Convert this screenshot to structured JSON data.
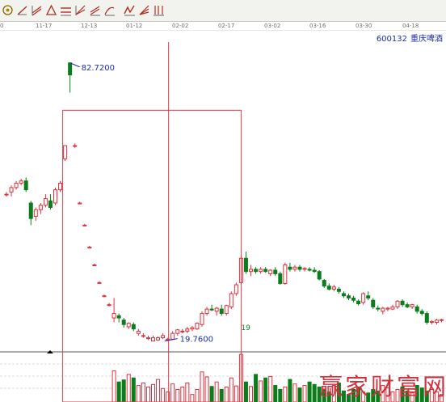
{
  "toolbar": {
    "buttons": [
      {
        "icon": "ring-icon"
      },
      {
        "icon": "trend-line-icon"
      },
      {
        "icon": "parallel-lines-icon"
      },
      {
        "icon": "triangle-icon"
      },
      {
        "icon": "horizontal-line-icon"
      },
      {
        "icon": "fan-lines-icon"
      },
      {
        "icon": "channel-icon"
      },
      {
        "icon": "arc-lines-icon"
      },
      {
        "icon": "zigzag-icon"
      },
      {
        "icon": "gann-fan-icon"
      }
    ]
  },
  "stock": {
    "code": "600132",
    "name": "重庆啤酒"
  },
  "dates": [
    "0",
    "11-17",
    "12-13",
    "01-12",
    "02-02",
    "02-17",
    "03-02",
    "03-16",
    "03-30",
    "04-18"
  ],
  "watermark": "赢家财富网",
  "colors": {
    "up": "#e0303c",
    "down": "#0b7d1c",
    "box": "#e03c48",
    "annotation": "#1a2fa8"
  },
  "chart_data": {
    "type": "candlestick",
    "price_range": [
      17.5,
      90
    ],
    "volume_range": [
      0,
      100
    ],
    "annotations": [
      {
        "text": "82.7200",
        "candle": 12
      },
      {
        "text": "19.7600",
        "candle": 33
      }
    ],
    "markers": [
      {
        "text": "19",
        "candle": 48
      }
    ],
    "box": {
      "from_candle": 12,
      "to_candle": 48,
      "low": 19.76,
      "high": 72.0
    },
    "vertical_line_candle": 33,
    "candles": [
      [
        53,
        53.5,
        52.5,
        53
      ],
      [
        53.5,
        55,
        52.5,
        54.5
      ],
      [
        54.5,
        56,
        54,
        55.5
      ],
      [
        55.5,
        56.5,
        55,
        56
      ],
      [
        56,
        56.8,
        53.5,
        54
      ],
      [
        51,
        51.5,
        46,
        47.5
      ],
      [
        48,
        50,
        47,
        49.5
      ],
      [
        49.5,
        51,
        48.5,
        50.5
      ],
      [
        50.5,
        53,
        50,
        52
      ],
      [
        51.5,
        53,
        49.5,
        50
      ],
      [
        51,
        54.5,
        50.5,
        54
      ],
      [
        54,
        56,
        53.5,
        55.5
      ],
      [
        61,
        64,
        60.5,
        64
      ],
      [
        82.72,
        82.72,
        76,
        80
      ],
      [
        64,
        64.5,
        63.5,
        64
      ],
      [
        51,
        51.3,
        50.7,
        51
      ],
      [
        46,
        46.3,
        45.7,
        46
      ],
      [
        41,
        41.3,
        40.7,
        41
      ],
      [
        37,
        37.3,
        36.7,
        37
      ],
      [
        33,
        33.3,
        32.7,
        33
      ],
      [
        30,
        30.3,
        29.7,
        30
      ],
      [
        28,
        28.4,
        27.6,
        28
      ],
      [
        25,
        29.5,
        24,
        26
      ],
      [
        25.5,
        26,
        24,
        25
      ],
      [
        24.5,
        25,
        22.8,
        23.5
      ],
      [
        23,
        24,
        22.5,
        23.8
      ],
      [
        23.5,
        24,
        22,
        22.5
      ],
      [
        21.5,
        22.5,
        21,
        22
      ],
      [
        21,
        21.5,
        20.5,
        21
      ],
      [
        20.5,
        21,
        20,
        20.5
      ],
      [
        19.76,
        21,
        19.76,
        20.5
      ],
      [
        20,
        20.8,
        19.8,
        20.5
      ],
      [
        20.5,
        21.5,
        20.2,
        21
      ],
      [
        20,
        20.5,
        19.76,
        20.2
      ],
      [
        20.2,
        22,
        20,
        21.5
      ],
      [
        21.5,
        22.5,
        21,
        22.3
      ],
      [
        22,
        22.5,
        21.5,
        22
      ],
      [
        22,
        23,
        21.5,
        22.5
      ],
      [
        22.5,
        23.2,
        22,
        22.8
      ],
      [
        22.5,
        24,
        22.3,
        23.8
      ],
      [
        23.5,
        26.5,
        23,
        26
      ],
      [
        26,
        27.5,
        25.5,
        27
      ],
      [
        27,
        28,
        26.5,
        26.8
      ],
      [
        26.5,
        27.5,
        25.5,
        27.2
      ],
      [
        27,
        28,
        25.5,
        26
      ],
      [
        26,
        28,
        25.5,
        27.8
      ],
      [
        27.5,
        31,
        27,
        30.5
      ],
      [
        30.5,
        33,
        30,
        32.5
      ],
      [
        33,
        39,
        32.5,
        38.5
      ],
      [
        38.5,
        40,
        35,
        35.5
      ],
      [
        35.5,
        37,
        34.5,
        36
      ],
      [
        36,
        36.5,
        35,
        35.5
      ],
      [
        35.5,
        36.5,
        35,
        36
      ],
      [
        36,
        36.5,
        35.2,
        35.5
      ],
      [
        35,
        36,
        34.5,
        35.8
      ],
      [
        35.8,
        36.5,
        34.5,
        35
      ],
      [
        35,
        35.5,
        32.5,
        32.8
      ],
      [
        32.8,
        37.5,
        32.5,
        37
      ],
      [
        36.5,
        37.5,
        35.5,
        36
      ],
      [
        36,
        37,
        35.5,
        36.5
      ],
      [
        36.5,
        37,
        35.5,
        36
      ],
      [
        36,
        36.5,
        35.5,
        36.2
      ],
      [
        36,
        36.5,
        35.5,
        35.8
      ],
      [
        35.8,
        36.5,
        35.2,
        35.5
      ],
      [
        35.5,
        35.8,
        33.5,
        33.8
      ],
      [
        33.5,
        33.8,
        31.8,
        32.2
      ],
      [
        32.2,
        32.8,
        31.2,
        31.5
      ],
      [
        31.5,
        32.5,
        31,
        32
      ],
      [
        31.5,
        32,
        30.5,
        31
      ],
      [
        30.5,
        31,
        29.5,
        30
      ],
      [
        30,
        30.5,
        29,
        29.5
      ],
      [
        29.5,
        30,
        28.5,
        29
      ],
      [
        28.8,
        29.2,
        27.8,
        28.2
      ],
      [
        28.5,
        30.8,
        28,
        30.5
      ],
      [
        30,
        31,
        29,
        29.5
      ],
      [
        29,
        29.5,
        27,
        27.5
      ],
      [
        27.2,
        27.8,
        26.5,
        27
      ],
      [
        26.5,
        27.5,
        25.8,
        27.2
      ],
      [
        27,
        27.5,
        26.5,
        27.2
      ],
      [
        27,
        28,
        26.8,
        27.5
      ],
      [
        27.5,
        29,
        27,
        28.8
      ],
      [
        28.8,
        29.2,
        27.5,
        28
      ],
      [
        28,
        28.5,
        27.2,
        27.5
      ],
      [
        27.5,
        28.2,
        27,
        28
      ],
      [
        27.5,
        28,
        26,
        26.5
      ],
      [
        26.5,
        27,
        25.5,
        26
      ],
      [
        26,
        26.5,
        23.5,
        24
      ],
      [
        24,
        24.5,
        23.5,
        24.2
      ],
      [
        24,
        24.8,
        23.5,
        24.5
      ],
      [
        24.5,
        24.8,
        24,
        24.6
      ]
    ],
    "volumes": [
      0,
      0,
      0,
      0,
      0,
      0,
      0,
      0,
      0,
      0,
      0,
      0,
      0,
      0,
      0,
      0,
      0,
      0,
      0,
      0,
      0,
      0,
      62,
      40,
      44,
      55,
      48,
      33,
      38,
      30,
      35,
      45,
      27,
      20,
      36,
      25,
      30,
      38,
      15,
      25,
      60,
      50,
      31,
      40,
      25,
      30,
      48,
      32,
      95,
      40,
      31,
      55,
      42,
      48,
      51,
      33,
      25,
      30,
      45,
      36,
      28,
      33,
      40,
      35,
      30,
      25,
      20,
      33,
      38,
      22,
      15,
      25,
      30,
      20,
      18,
      25,
      22,
      33,
      28,
      20,
      25,
      30,
      22,
      18,
      33,
      28,
      22,
      25,
      20,
      15
    ]
  }
}
